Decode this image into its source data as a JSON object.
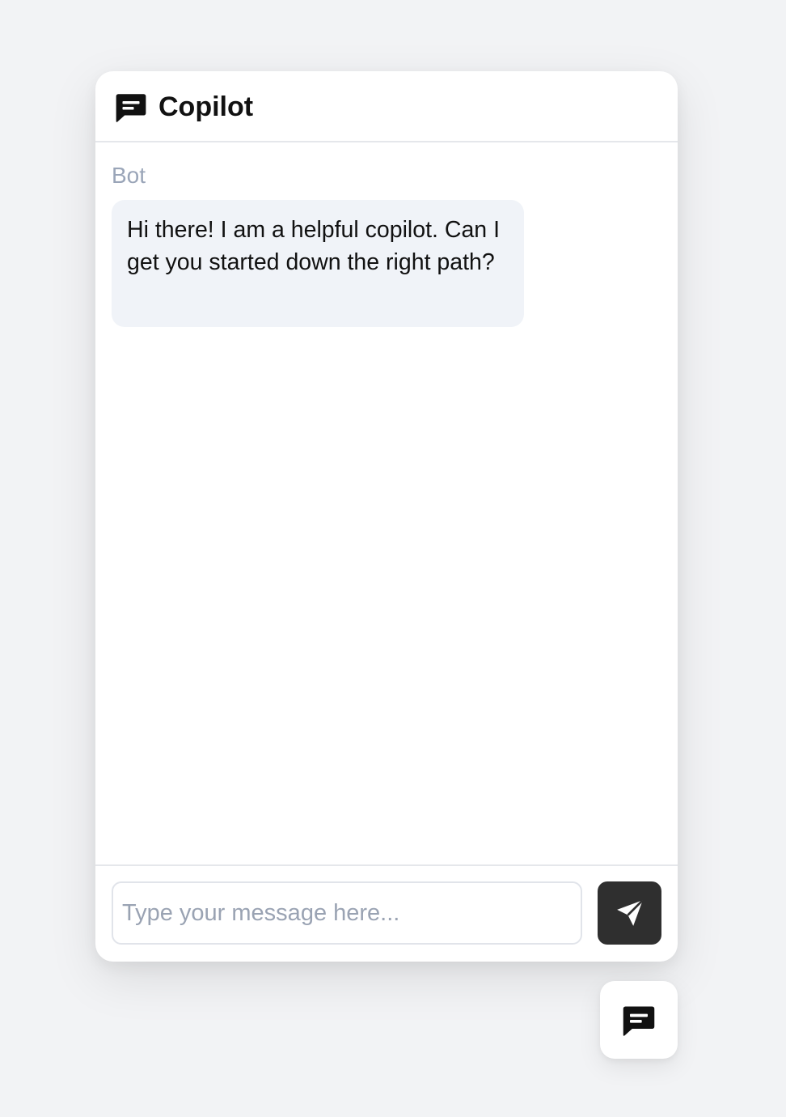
{
  "header": {
    "title": "Copilot",
    "icon": "chat-icon"
  },
  "messages": [
    {
      "sender": "Bot",
      "text": "Hi there! I am a helpful copilot. Can I get you started down the right path?"
    }
  ],
  "composer": {
    "placeholder": "Type your message here...",
    "value": "",
    "send_icon": "send-icon"
  },
  "launcher": {
    "icon": "chat-icon"
  },
  "colors": {
    "background": "#f2f3f5",
    "panel": "#ffffff",
    "bubble": "#f0f3f8",
    "sender_label": "#9aa5b8",
    "send_button": "#2f2f2f",
    "text": "#111111"
  }
}
